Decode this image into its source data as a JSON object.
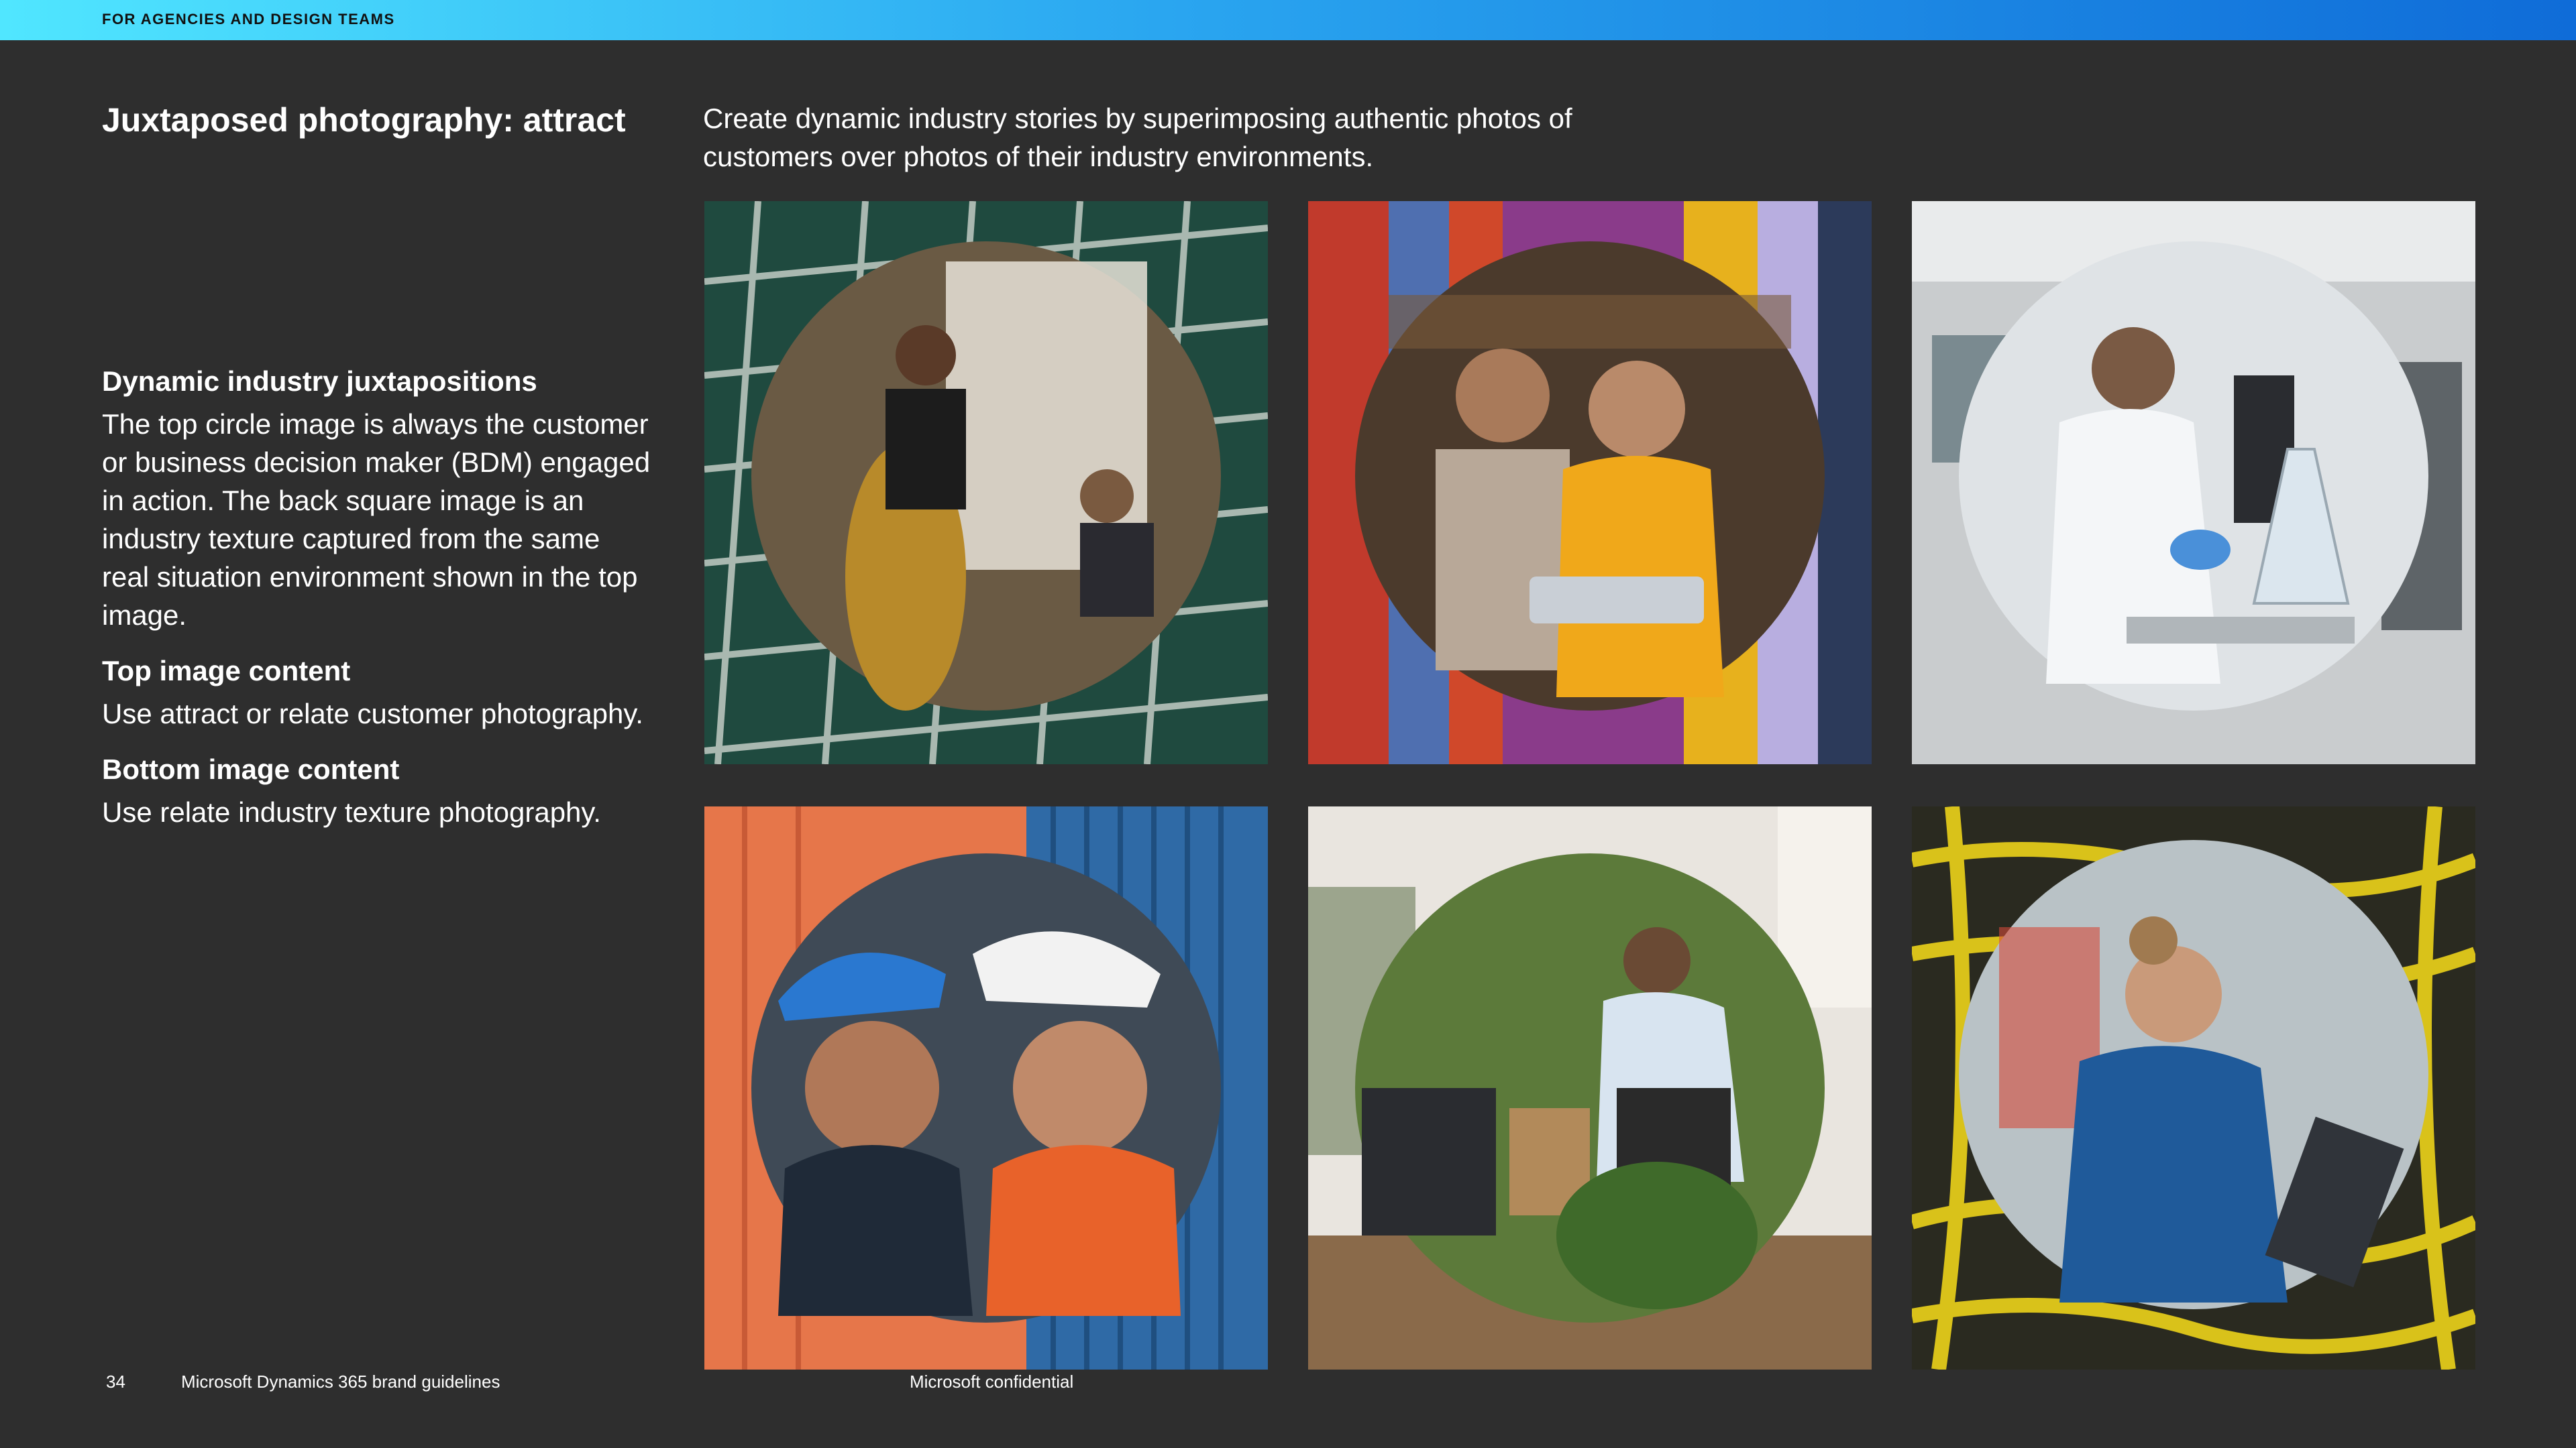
{
  "header": {
    "label": "FOR AGENCIES AND DESIGN TEAMS"
  },
  "title": "Juxtaposed photography: attract",
  "intro": "Create dynamic industry stories by superimposing authentic photos of customers over photos of their industry environments.",
  "sections": [
    {
      "heading": "Dynamic industry juxtapositions",
      "body": "The top circle image is always the customer or business decision maker (BDM) engaged in action. The back square image is an industry texture captured from the same real situation environment shown in the top image."
    },
    {
      "heading": "Top image content",
      "body": "Use attract or relate customer photography."
    },
    {
      "heading": "Bottom image content",
      "body": "Use relate industry texture photography."
    }
  ],
  "images": [
    {
      "name": "office-meeting-photo",
      "colors": {
        "back": "#1f4a3f",
        "back2": "#d8ddd6",
        "circle": "#6a5a44",
        "accent": "#b88a2a"
      }
    },
    {
      "name": "fabric-store-photo",
      "colors": {
        "back": "#c13a2c",
        "back2": "#e7b11d",
        "circle": "#4b3a2c",
        "accent": "#f0a81a"
      }
    },
    {
      "name": "lab-scientist-photo",
      "colors": {
        "back": "#c9ccce",
        "back2": "#e9ebec",
        "circle": "#dfe3e6",
        "accent": "#4a90d9"
      }
    },
    {
      "name": "shipping-containers-photo",
      "colors": {
        "back": "#e6764a",
        "back2": "#2f6aa6",
        "circle": "#3f4a56",
        "accent": "#2a78d0"
      }
    },
    {
      "name": "cafe-delivery-photo",
      "colors": {
        "back": "#e9e5df",
        "back2": "#8a6a4a",
        "circle": "#5c7a3a",
        "accent": "#b28a5a"
      }
    },
    {
      "name": "cable-technician-photo",
      "colors": {
        "back": "#d9c21a",
        "back2": "#2a2a20",
        "circle": "#b9c2c6",
        "accent": "#1f5a9a"
      }
    }
  ],
  "footer": {
    "page_number": "34",
    "brand": "Microsoft Dynamics 365 brand guidelines",
    "confidential": "Microsoft confidential"
  }
}
